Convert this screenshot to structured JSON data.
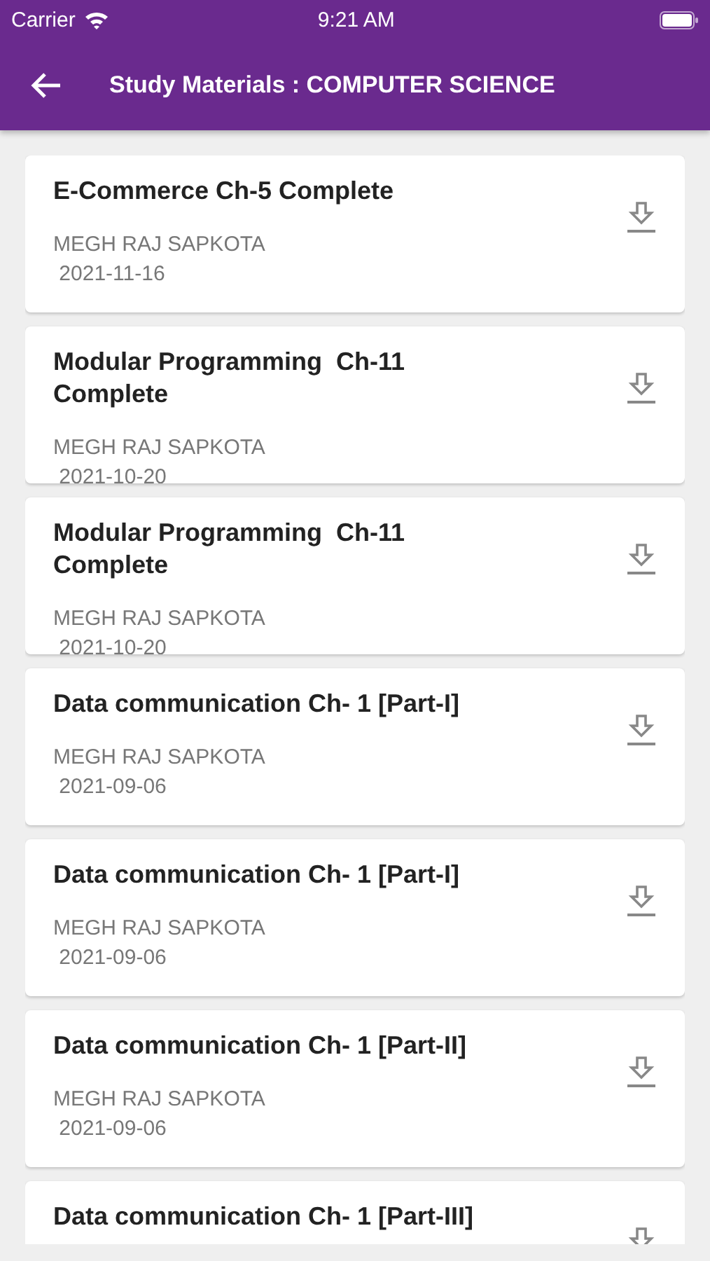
{
  "status_bar": {
    "carrier": "Carrier",
    "time": "9:21 AM"
  },
  "app_bar": {
    "title": "Study Materials : COMPUTER SCIENCE"
  },
  "materials": [
    {
      "title": "E-Commerce Ch-5 Complete",
      "author": "MEGH RAJ SAPKOTA",
      "date": " 2021-11-16"
    },
    {
      "title": "Modular Programming  Ch-11 Complete",
      "author": "MEGH RAJ SAPKOTA",
      "date": " 2021-10-20"
    },
    {
      "title": "Modular Programming  Ch-11 Complete",
      "author": "MEGH RAJ SAPKOTA",
      "date": " 2021-10-20"
    },
    {
      "title": "Data communication Ch- 1 [Part-I]",
      "author": "MEGH RAJ SAPKOTA",
      "date": " 2021-09-06"
    },
    {
      "title": "Data communication Ch- 1 [Part-I]",
      "author": "MEGH RAJ SAPKOTA",
      "date": " 2021-09-06"
    },
    {
      "title": "Data communication Ch- 1 [Part-II]",
      "author": "MEGH RAJ SAPKOTA",
      "date": " 2021-09-06"
    },
    {
      "title": "Data communication Ch- 1 [Part-III]"
    }
  ]
}
